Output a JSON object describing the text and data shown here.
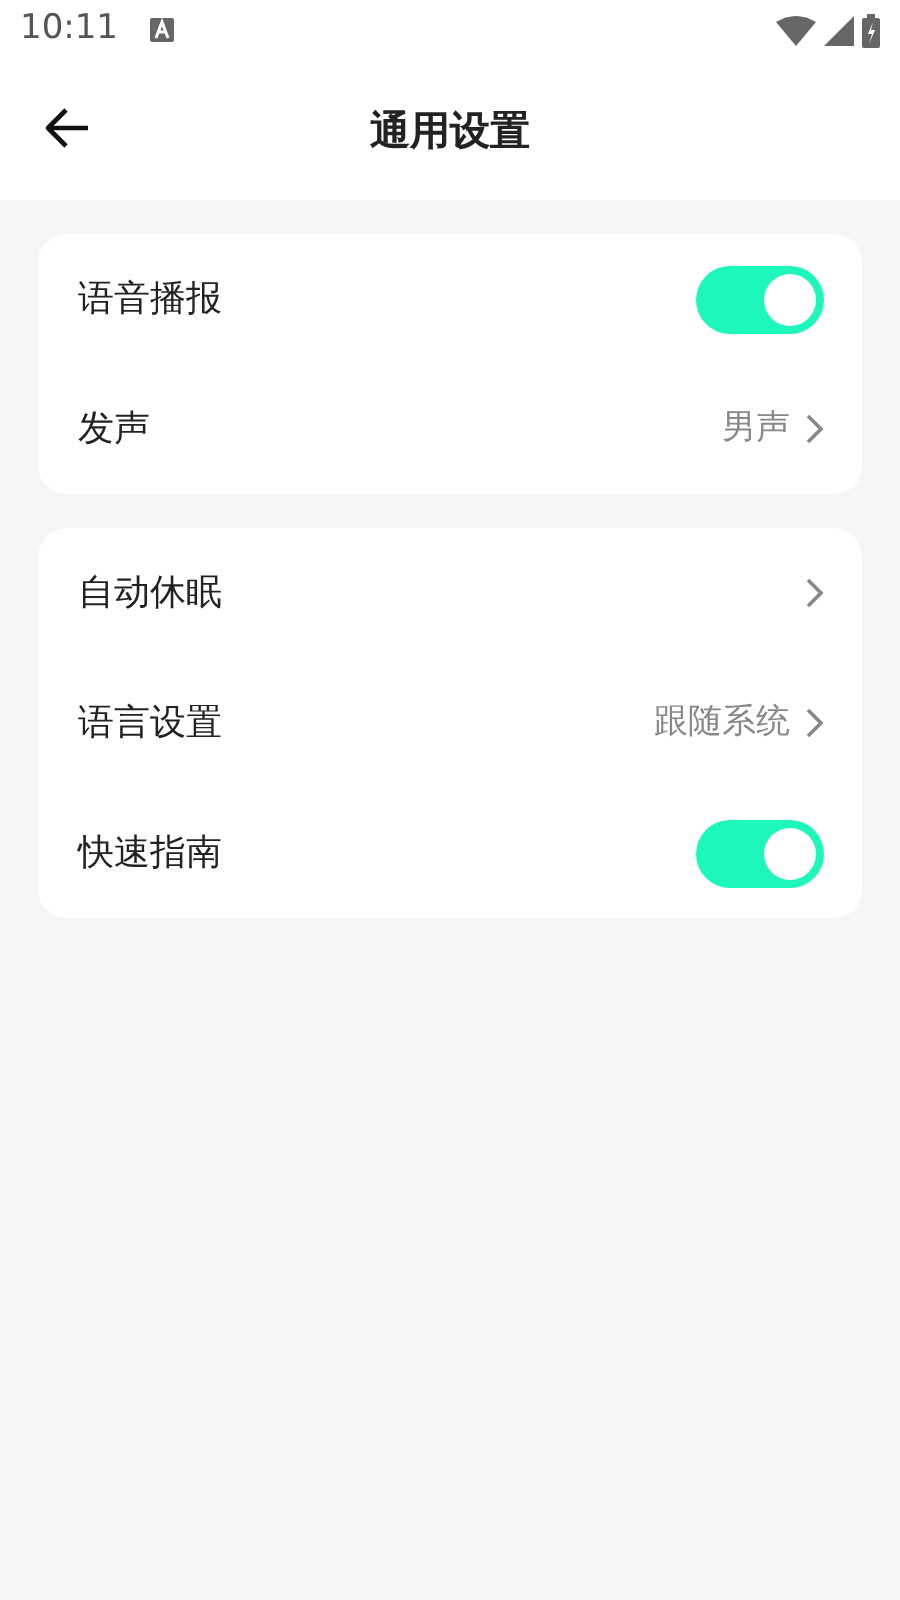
{
  "status_bar": {
    "time": "10:11"
  },
  "header": {
    "title": "通用设置"
  },
  "groups": [
    {
      "rows": [
        {
          "label": "语音播报",
          "kind": "toggle",
          "on": true
        },
        {
          "label": "发声",
          "kind": "link",
          "value": "男声"
        }
      ]
    },
    {
      "rows": [
        {
          "label": "自动休眠",
          "kind": "link"
        },
        {
          "label": "语言设置",
          "kind": "link",
          "value": "跟随系统"
        },
        {
          "label": "快速指南",
          "kind": "toggle",
          "on": true
        }
      ]
    }
  ]
}
